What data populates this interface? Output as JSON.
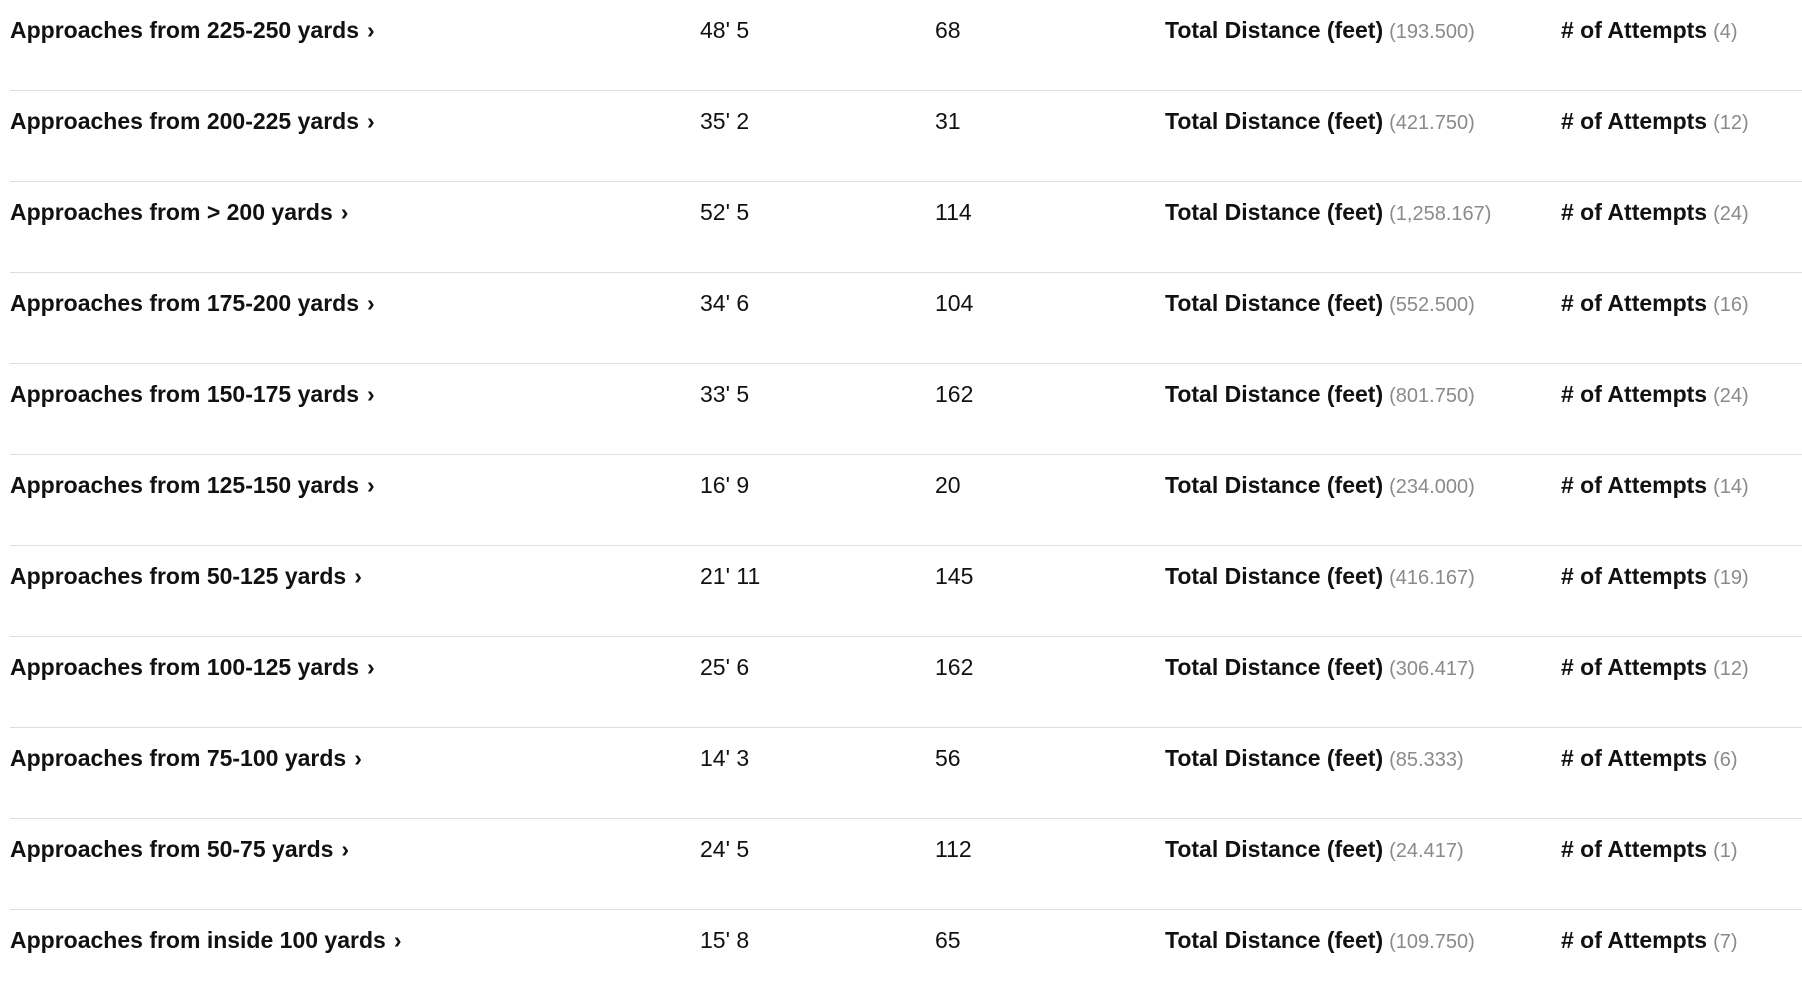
{
  "labels": {
    "total_distance": "Total Distance (feet)",
    "attempts": "# of Attempts",
    "chevron": "›"
  },
  "rows": [
    {
      "category": "Approaches from 225-250 yards",
      "avg": "48' 5",
      "rank": "68",
      "total": "(193.500)",
      "attempts": "(4)"
    },
    {
      "category": "Approaches from 200-225 yards",
      "avg": "35' 2",
      "rank": "31",
      "total": "(421.750)",
      "attempts": "(12)"
    },
    {
      "category": "Approaches from > 200 yards",
      "avg": "52' 5",
      "rank": "114",
      "total": "(1,258.167)",
      "attempts": "(24)"
    },
    {
      "category": "Approaches from 175-200 yards",
      "avg": "34' 6",
      "rank": "104",
      "total": "(552.500)",
      "attempts": "(16)"
    },
    {
      "category": "Approaches from 150-175 yards",
      "avg": "33' 5",
      "rank": "162",
      "total": "(801.750)",
      "attempts": "(24)"
    },
    {
      "category": "Approaches from 125-150 yards",
      "avg": "16' 9",
      "rank": "20",
      "total": "(234.000)",
      "attempts": "(14)"
    },
    {
      "category": "Approaches from 50-125 yards",
      "avg": "21' 11",
      "rank": "145",
      "total": "(416.167)",
      "attempts": "(19)"
    },
    {
      "category": "Approaches from 100-125 yards",
      "avg": "25' 6",
      "rank": "162",
      "total": "(306.417)",
      "attempts": "(12)"
    },
    {
      "category": "Approaches from 75-100 yards",
      "avg": "14' 3",
      "rank": "56",
      "total": "(85.333)",
      "attempts": "(6)"
    },
    {
      "category": "Approaches from 50-75 yards",
      "avg": "24' 5",
      "rank": "112",
      "total": "(24.417)",
      "attempts": "(1)"
    },
    {
      "category": "Approaches from inside 100 yards",
      "avg": "15' 8",
      "rank": "65",
      "total": "(109.750)",
      "attempts": "(7)"
    }
  ]
}
